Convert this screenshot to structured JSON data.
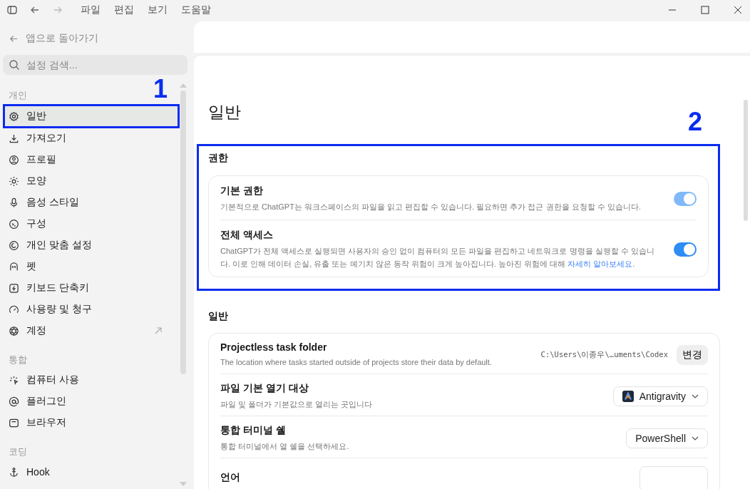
{
  "menu_bar": {
    "menus": [
      "파일",
      "편집",
      "보기",
      "도움말"
    ]
  },
  "sidebar": {
    "back_link": "앱으로 돌아가기",
    "search": {
      "placeholder": "설정 검색..."
    },
    "sections": [
      {
        "title": "개인",
        "items": [
          {
            "label": "일반",
            "selected": true,
            "external": false,
            "annotation_label": "1"
          },
          {
            "label": "가져오기",
            "selected": false,
            "external": false
          },
          {
            "label": "프로필",
            "selected": false,
            "external": false
          },
          {
            "label": "모양",
            "selected": false,
            "external": false
          },
          {
            "label": "음성 스타일",
            "selected": false,
            "external": false
          },
          {
            "label": "구성",
            "selected": false,
            "external": false
          },
          {
            "label": "개인 맞춤 설정",
            "selected": false,
            "external": false
          },
          {
            "label": "펫",
            "selected": false,
            "external": false
          },
          {
            "label": "키보드 단축키",
            "selected": false,
            "external": false
          },
          {
            "label": "사용량 및 청구",
            "selected": false,
            "external": false
          },
          {
            "label": "계정",
            "selected": false,
            "external": true
          }
        ]
      },
      {
        "title": "통합",
        "items": [
          {
            "label": "컴퓨터 사용",
            "selected": false,
            "external": false
          },
          {
            "label": "플러그인",
            "selected": false,
            "external": false
          },
          {
            "label": "브라우저",
            "selected": false,
            "external": false
          }
        ]
      },
      {
        "title": "코딩",
        "items": [
          {
            "label": "Hook",
            "selected": false,
            "external": false
          }
        ]
      }
    ]
  },
  "page": {
    "title": "일반",
    "permissions": {
      "title": "권한",
      "annotation_label": "2",
      "rows": [
        {
          "title": "기본 권한",
          "description": "기본적으로 ChatGPT는 워크스페이스의 파일을 읽고 편집할 수 있습니다. 필요하면 추가 접근 권한을 요청할 수 있습니다.",
          "on": true,
          "disabled": true
        },
        {
          "title": "전체 액세스",
          "description": "ChatGPT가 전체 액세스로 실행되면 사용자의 승인 없이 컴퓨터의 모든 파일을 편집하고 네트워크로 명령을 실행할 수 있습니다. 이로 인해 데이터 손실, 유출 또는 예기치 않은 동작 위험이 크게 높아집니다. 높아진 위험에 대해 ",
          "link": "자세히 알아보세요",
          "after_link": ".",
          "on": true,
          "disabled": false
        }
      ]
    },
    "general": {
      "title": "일반",
      "rows": [
        {
          "kind": "path",
          "title": "Projectless task folder",
          "description": "The location where tasks started outside of projects store their data by default.",
          "path": "C:\\Users\\이종우\\…uments\\Codex",
          "button": "변경"
        },
        {
          "kind": "dropdown",
          "title": "파일 기본 열기 대상",
          "description": "파일 및 폴더가 기본값으로 열리는 곳입니다",
          "value": "Antigravity",
          "app_icon": true
        },
        {
          "kind": "dropdown",
          "title": "통합 터미널 쉘",
          "description": "통합 터미널에서 열 쉘을 선택하세요.",
          "value": "PowerShell",
          "app_icon": false
        },
        {
          "kind": "dropdown",
          "title": "언어"
        }
      ]
    }
  }
}
